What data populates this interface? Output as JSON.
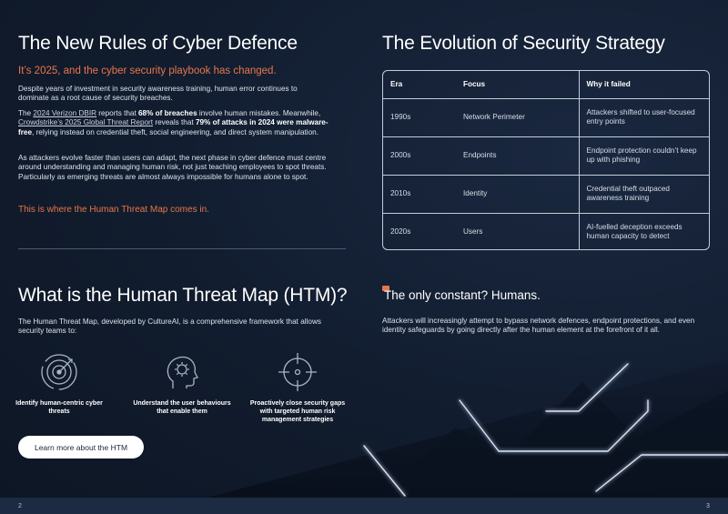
{
  "left": {
    "title": "The New Rules of Cyber Defence",
    "subhead": "It’s 2025, and the cyber security playbook has changed.",
    "p1": "Despite years of investment in security awareness training, human error continues to dominate as a root cause of security breaches.",
    "p2": {
      "a": "The ",
      "link1": "2024 Verizon DBIR",
      "b": " reports that ",
      "bold1": "68% of breaches",
      "c": " involve human mistakes. Meanwhile, ",
      "link2": "Crowdstrike’s 2025 Global Threat Report",
      "d": " reveals that ",
      "bold2": "79% of attacks in 2024 were malware-free",
      "e": ", relying instead on credential theft, social engineering, and direct system manipulation."
    },
    "p3": "As attackers evolve faster than users can adapt, the next phase in cyber defence must centre around understanding and managing human risk, not just teaching employees to spot threats. Particularly as emerging threats are almost always impossible for humans alone to spot.",
    "callout": "This is where the Human Threat Map comes in."
  },
  "htm": {
    "title": "What is the Human Threat Map (HTM)?",
    "intro": "The Human Threat Map, developed by CultureAI, is a comprehensive framework that allows security teams to:",
    "features": [
      {
        "label": "Identify human-centric cyber threats",
        "icon": "target-icon"
      },
      {
        "label": "Understand the user behaviours that enable them",
        "icon": "head-gear-icon"
      },
      {
        "label": "Proactively close security gaps with targeted human risk management strategies",
        "icon": "crosshair-icon"
      }
    ],
    "cta": "Learn more about the HTM"
  },
  "evolution": {
    "title": "The Evolution of Security Strategy",
    "headers": [
      "Era",
      "Focus",
      "Why it failed"
    ],
    "rows": [
      [
        "1990s",
        "Network Perimeter",
        "Attackers shifted to user-focused entry points"
      ],
      [
        "2000s",
        "Endpoints",
        "Endpoint protection couldn’t keep up with phishing"
      ],
      [
        "2010s",
        "Identity",
        "Credential theft outpaced awareness training"
      ],
      [
        "2020s",
        "Users",
        "AI-fuelled deception exceeds human capacity to detect"
      ]
    ]
  },
  "constant": {
    "title": "The only constant? Humans.",
    "body": "Attackers will increasingly attempt to bypass network defences, endpoint protections, and even identity safeguards by going directly after the human element at the forefront of it all."
  },
  "footer": {
    "left_page": "2",
    "right_page": "3"
  },
  "colors": {
    "accent": "#e8764a",
    "background": "#0f1a2b",
    "glow": "#cfe0ff"
  }
}
